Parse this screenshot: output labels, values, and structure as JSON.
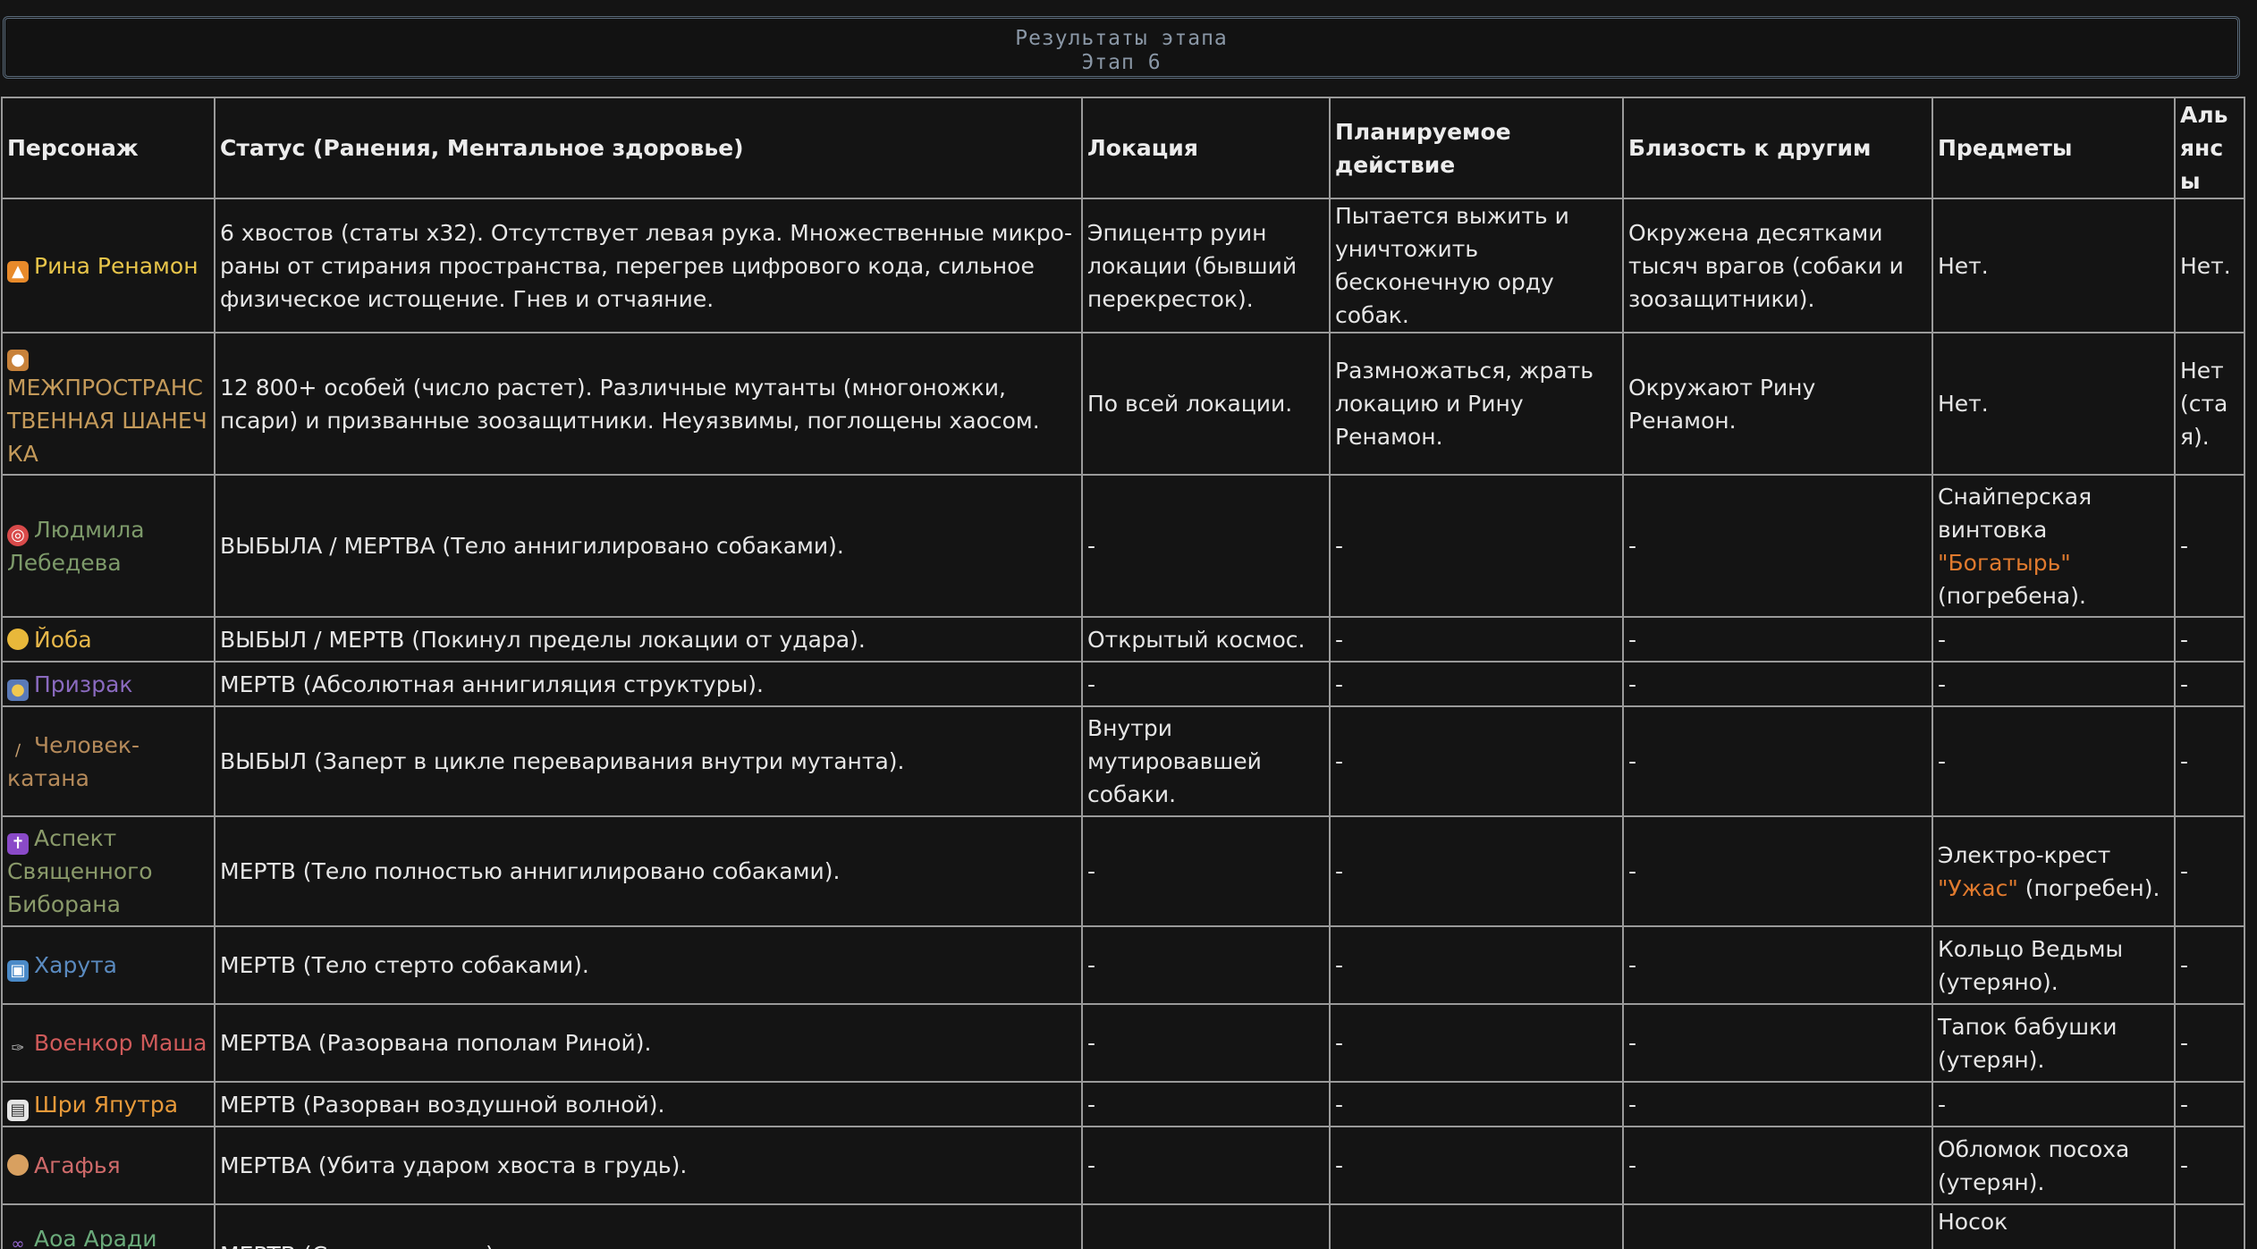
{
  "stage": {
    "title": "Результаты этапа",
    "subtitle": "Этап 6"
  },
  "table": {
    "headers": {
      "character": "Персонаж",
      "status": "Статус (Ранения, Ментальное здоровье)",
      "location": "Локация",
      "action": "Планируемое действие",
      "closeness": "Близость к другим",
      "items": "Предметы",
      "alliances": "Альянсы"
    },
    "rows": [
      {
        "name": "Рина Ренамон",
        "icon": "fox-icon",
        "status": "6 хвостов (статы x32). Отсутствует левая рука. Множественные микро-раны от стирания пространства, перегрев цифрового кода, сильное физическое истощение. Гнев и отчаяние.",
        "location": "Эпицентр руин локации (бывший перекресток).",
        "action": "Пытается выжить и уничтожить бесконечную орду собак.",
        "closeness": "Окружена десятками тысяч врагов (собаки и зоозащитники).",
        "items": "Нет.",
        "alliances": "Нет."
      },
      {
        "name": "МЕЖПРОСТРАНСТВЕННАЯ ШАНЕЧКА",
        "icon": "cat-icon",
        "status": "12 800+ особей (число растет). Различные мутанты (многоножки, псари) и призванные зоозащитники. Неуязвимы, поглощены хаосом.",
        "location": "По всей локации.",
        "action": "Размножаться, жрать локацию и Рину Ренамон.",
        "closeness": "Окружают Рину Ренамон.",
        "items": "Нет.",
        "alliances": "Нет (стая)."
      },
      {
        "name": "Людмила Лебедева",
        "icon": "target-icon",
        "status": "ВЫБЫЛА / МЕРТВА (Тело аннигилировано собаками).",
        "location": "-",
        "action": "-",
        "closeness": "-",
        "items_pre": "Снайперская винтовка",
        "items_hl": "\"Богатырь\"",
        "items_post": "(погребена).",
        "alliances": "-"
      },
      {
        "name": "Йоба",
        "icon": "face-icon",
        "status": "ВЫБЫЛ / МЕРТВ (Покинул пределы локации от удара).",
        "location": "Открытый космос.",
        "action": "-",
        "closeness": "-",
        "items": "-",
        "alliances": "-"
      },
      {
        "name": "Призрак",
        "icon": "mask-icon",
        "status": "МЕРТВ (Абсолютная аннигиляция структуры).",
        "location": "-",
        "action": "-",
        "closeness": "-",
        "items": "-",
        "alliances": "-"
      },
      {
        "name": "Человек-катана",
        "icon": "dagger-icon",
        "status": "ВЫБЫЛ (Заперт в цикле переваривания внутри мутанта).",
        "location": "Внутри мутировавшей собаки.",
        "action": "-",
        "closeness": "-",
        "items": "-",
        "alliances": "-"
      },
      {
        "name": "Аспект Священного Биборана",
        "icon": "cross-icon",
        "status": "МЕРТВ (Тело полностью аннигилировано собаками).",
        "location": "-",
        "action": "-",
        "closeness": "-",
        "items_pre": "Электро-крест",
        "items_hl": "\"Ужас\"",
        "items_post": "(погребен).",
        "alliances": "-"
      },
      {
        "name": "Харута",
        "icon": "tv-icon",
        "status": "МЕРТВ (Тело стерто собаками).",
        "location": "-",
        "action": "-",
        "closeness": "-",
        "items": "Кольцо Ведьмы (утеряно).",
        "alliances": "-"
      },
      {
        "name": "Военкор Маша",
        "icon": "microphone-icon",
        "status": "МЕРТВА (Разорвана пополам Риной).",
        "location": "-",
        "action": "-",
        "closeness": "-",
        "items": "Тапок бабушки (утерян).",
        "alliances": "-"
      },
      {
        "name": "Шри Япутра",
        "icon": "clapper-icon",
        "status": "МЕРТВ (Разорван воздушной волной).",
        "location": "-",
        "action": "-",
        "closeness": "-",
        "items": "-",
        "alliances": "-"
      },
      {
        "name": "Агафья",
        "icon": "bread-icon",
        "status": "МЕРТВА (Убита ударом хвоста в грудь).",
        "location": "-",
        "action": "-",
        "closeness": "-",
        "items": "Обломок посоха (утерян).",
        "alliances": "-"
      },
      {
        "name": "Аоа Аради Тагадаш",
        "icon": "glasses-icon",
        "status": "МЕРТВ (Сгнил изнутри).",
        "location": "-",
        "action": "-",
        "closeness": "-",
        "items": "Носок телепортации (утерян).",
        "alliances": "-"
      }
    ]
  }
}
